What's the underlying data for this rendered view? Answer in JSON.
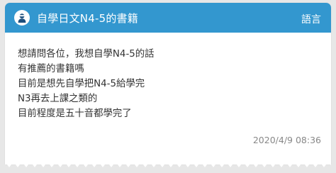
{
  "header": {
    "title": "自學日文N4-5的書籍",
    "lang_button": "語言",
    "avatar_icon": "anonymous-user-icon",
    "bg_color": "#3397cf"
  },
  "post": {
    "lines": [
      "想請問各位，我想自學N4-5的話",
      "有推薦的書籍嗎",
      "目前是想先自學把N4-5給學完",
      "N3再去上課之類的",
      "目前程度是五十音都學完了"
    ],
    "timestamp": "2020/4/9 08:36"
  }
}
